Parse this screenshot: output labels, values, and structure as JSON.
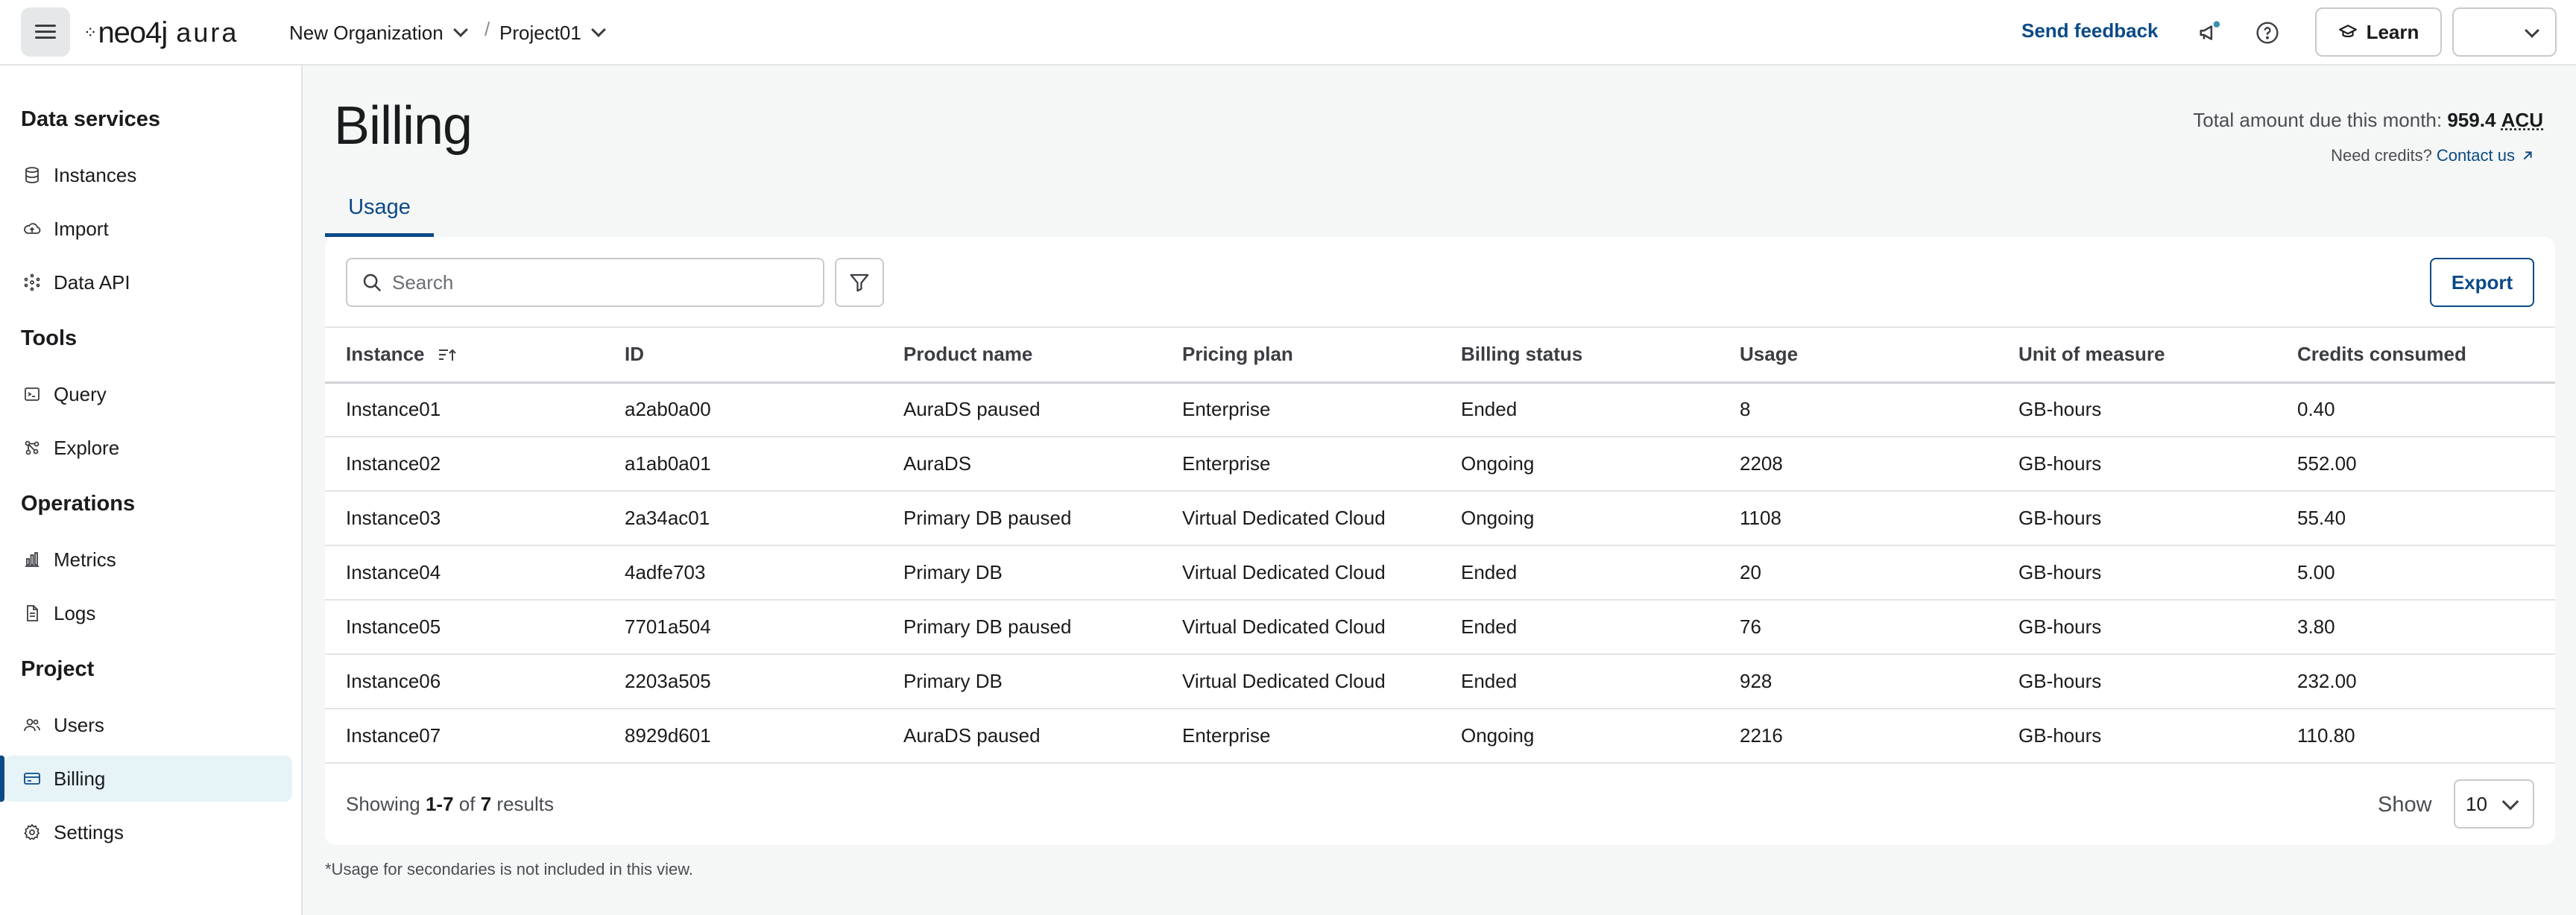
{
  "topbar": {
    "logo_mark": "neo4j",
    "logo_product": "aura",
    "organization": "New Organization",
    "project": "Project01",
    "separator": "/",
    "feedback": "Send feedback",
    "learn": "Learn"
  },
  "sidebar": {
    "sections": [
      {
        "heading": "Data services",
        "items": [
          "Instances",
          "Import",
          "Data API"
        ]
      },
      {
        "heading": "Tools",
        "items": [
          "Query",
          "Explore"
        ]
      },
      {
        "heading": "Operations",
        "items": [
          "Metrics",
          "Logs"
        ]
      },
      {
        "heading": "Project",
        "items": [
          "Users",
          "Billing",
          "Settings"
        ]
      }
    ],
    "active": "Billing"
  },
  "page": {
    "title": "Billing",
    "total_label": "Total amount due this month:",
    "total_value": "959.4",
    "total_unit": "ACU",
    "credits_prompt": "Need credits?",
    "credits_link": "Contact us",
    "tab": "Usage"
  },
  "toolbar": {
    "search_placeholder": "Search",
    "export": "Export"
  },
  "table": {
    "columns": [
      "Instance",
      "ID",
      "Product name",
      "Pricing plan",
      "Billing status",
      "Usage",
      "Unit of measure",
      "Credits consumed"
    ],
    "rows": [
      [
        "Instance01",
        "a2ab0a00",
        "AuraDS paused",
        "Enterprise",
        "Ended",
        "8",
        "GB-hours",
        "0.40"
      ],
      [
        "Instance02",
        "a1ab0a01",
        "AuraDS",
        "Enterprise",
        "Ongoing",
        "2208",
        "GB-hours",
        "552.00"
      ],
      [
        "Instance03",
        "2a34ac01",
        "Primary DB paused",
        "Virtual Dedicated Cloud",
        "Ongoing",
        "1108",
        "GB-hours",
        "55.40"
      ],
      [
        "Instance04",
        "4adfe703",
        "Primary DB",
        "Virtual Dedicated Cloud",
        "Ended",
        "20",
        "GB-hours",
        "5.00"
      ],
      [
        "Instance05",
        "7701a504",
        "Primary DB paused",
        "Virtual Dedicated Cloud",
        "Ended",
        "76",
        "GB-hours",
        "3.80"
      ],
      [
        "Instance06",
        "2203a505",
        "Primary DB",
        "Virtual Dedicated Cloud",
        "Ended",
        "928",
        "GB-hours",
        "232.00"
      ],
      [
        "Instance07",
        "8929d601",
        "AuraDS paused",
        "Enterprise",
        "Ongoing",
        "2216",
        "GB-hours",
        "110.80"
      ]
    ]
  },
  "pagination": {
    "showing_prefix": "Showing",
    "range": "1-7",
    "of": "of",
    "total": "7",
    "suffix": "results",
    "show_label": "Show",
    "page_size": "10"
  },
  "footnote": "*Usage for secondaries is not included in this view.",
  "colors": {
    "accent": "#0b4a87",
    "active_bg": "#e6f4f8",
    "badge_dot": "#3b8fb0"
  }
}
